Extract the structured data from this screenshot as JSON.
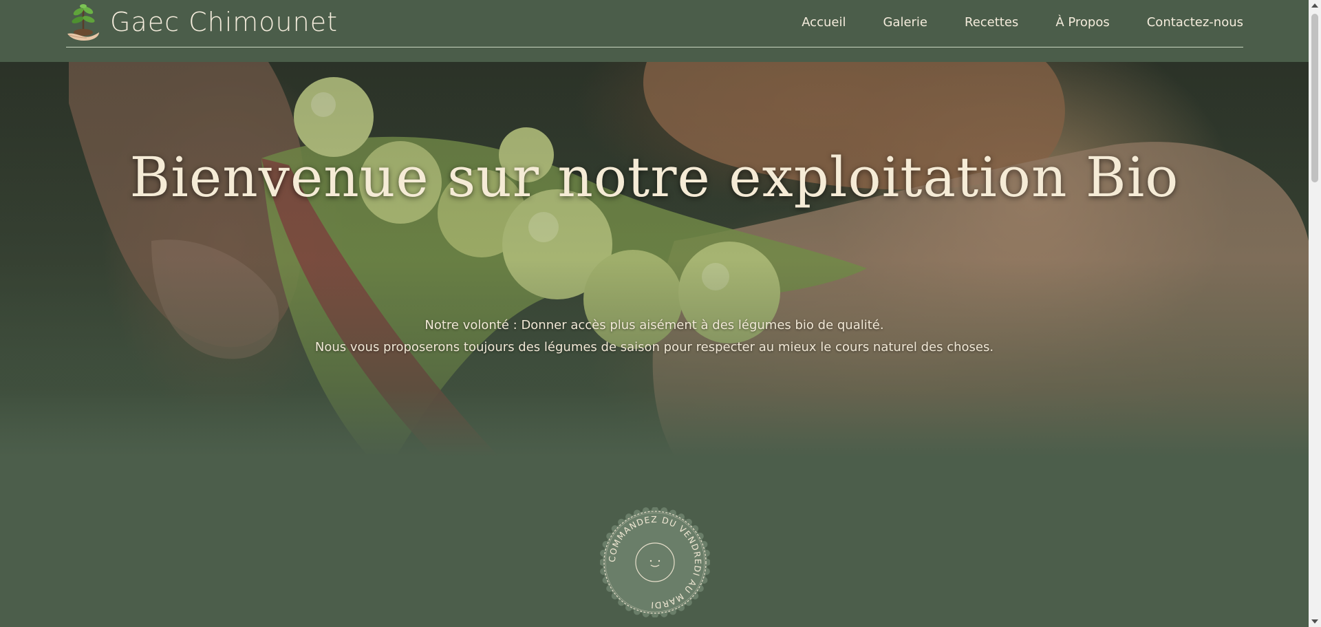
{
  "header": {
    "site_title": "Gaec Chimounet",
    "logo_icon": "seedling-in-hand-icon",
    "nav": [
      {
        "label": "Accueil"
      },
      {
        "label": "Galerie"
      },
      {
        "label": "Recettes"
      },
      {
        "label": "À Propos"
      },
      {
        "label": "Contactez-nous"
      }
    ]
  },
  "hero": {
    "title": "Bienvenue sur notre exploitation Bio",
    "line1": "Notre volonté : Donner accès plus aisément à des légumes bio de qualité.",
    "line2": "Nous vous proposerons toujours des légumes de saison pour respecter au mieux le cours naturel des choses.",
    "background_image": "hands-opening-pea-pod"
  },
  "badge": {
    "text": "COMMANDEZ DU VENDREDI AU MARDI",
    "center_icon": "smiley-face-icon"
  },
  "colors": {
    "header_bg": "#4b5d4a",
    "text_cream": "#f4ecdc",
    "badge_bg": "#6a7e69"
  }
}
